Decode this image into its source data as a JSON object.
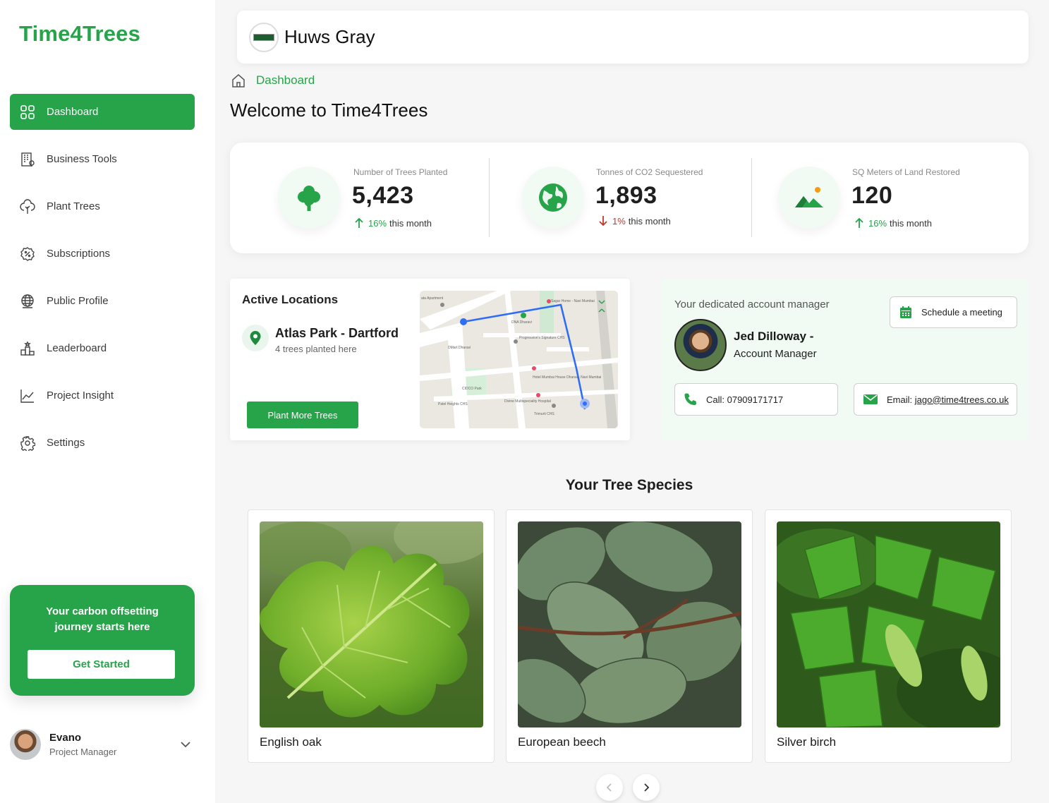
{
  "app": {
    "logo": "Time4Trees"
  },
  "sidebar": {
    "items": [
      {
        "label": "Dashboard",
        "icon": "dashboard-grid-icon",
        "active": true
      },
      {
        "label": "Business Tools",
        "icon": "building-icon"
      },
      {
        "label": "Plant Trees",
        "icon": "tree-icon"
      },
      {
        "label": "Subscriptions",
        "icon": "badge-percent-icon"
      },
      {
        "label": "Public Profile",
        "icon": "globe-icon"
      },
      {
        "label": "Leaderboard",
        "icon": "podium-icon"
      },
      {
        "label": "Project Insight",
        "icon": "line-chart-icon"
      },
      {
        "label": "Settings",
        "icon": "gear-icon"
      }
    ],
    "promo": {
      "text": "Your carbon offsetting journey starts here",
      "button": "Get Started"
    },
    "user": {
      "name": "Evano",
      "role": "Project Manager"
    }
  },
  "header": {
    "company": "Huws Gray"
  },
  "breadcrumb": {
    "label": "Dashboard"
  },
  "page": {
    "title": "Welcome to Time4Trees"
  },
  "stats": [
    {
      "label": "Number of Trees Planted",
      "value": "5,423",
      "change_pct": "16%",
      "change_text": "this month",
      "direction": "up",
      "icon": "tree-icon"
    },
    {
      "label": "Tonnes of CO2 Sequestered",
      "value": "1,893",
      "change_pct": "1%",
      "change_text": "this month",
      "direction": "down",
      "icon": "earth-icon"
    },
    {
      "label": "SQ Meters of Land Restored",
      "value": "120",
      "change_pct": "16%",
      "change_text": "this month",
      "direction": "up",
      "icon": "mountain-sun-icon"
    }
  ],
  "locations": {
    "title": "Active Locations",
    "name": "Atlas Park - Dartford",
    "subtitle": "4 trees planted here",
    "button": "Plant More Trees",
    "map_labels": [
      "ata Apartment",
      "Sagar Home - Navi Mumbai",
      "DNA Dharavi",
      "DMart Dharavi",
      "Progressive's Signature CHS",
      "CIDCO Park",
      "Hotel Mumbai House Dharavi, Navi Mumbai",
      "Divine Multispeciality Hospital",
      "Patel Heights CHS",
      "Trimurti CHS"
    ]
  },
  "manager": {
    "caption": "Your dedicated account manager",
    "schedule_button": "Schedule a meeting",
    "name": "Jed Dilloway -",
    "role": "Account Manager",
    "call_label": "Call: 07909171717",
    "email_prefix": "Email: ",
    "email": "jago@time4trees.co.uk"
  },
  "species": {
    "title": "Your Tree Species",
    "items": [
      {
        "name": "English oak"
      },
      {
        "name": "European beech"
      },
      {
        "name": "Silver birch"
      }
    ]
  },
  "colors": {
    "brand": "#27a34a",
    "down": "#c0392b"
  }
}
